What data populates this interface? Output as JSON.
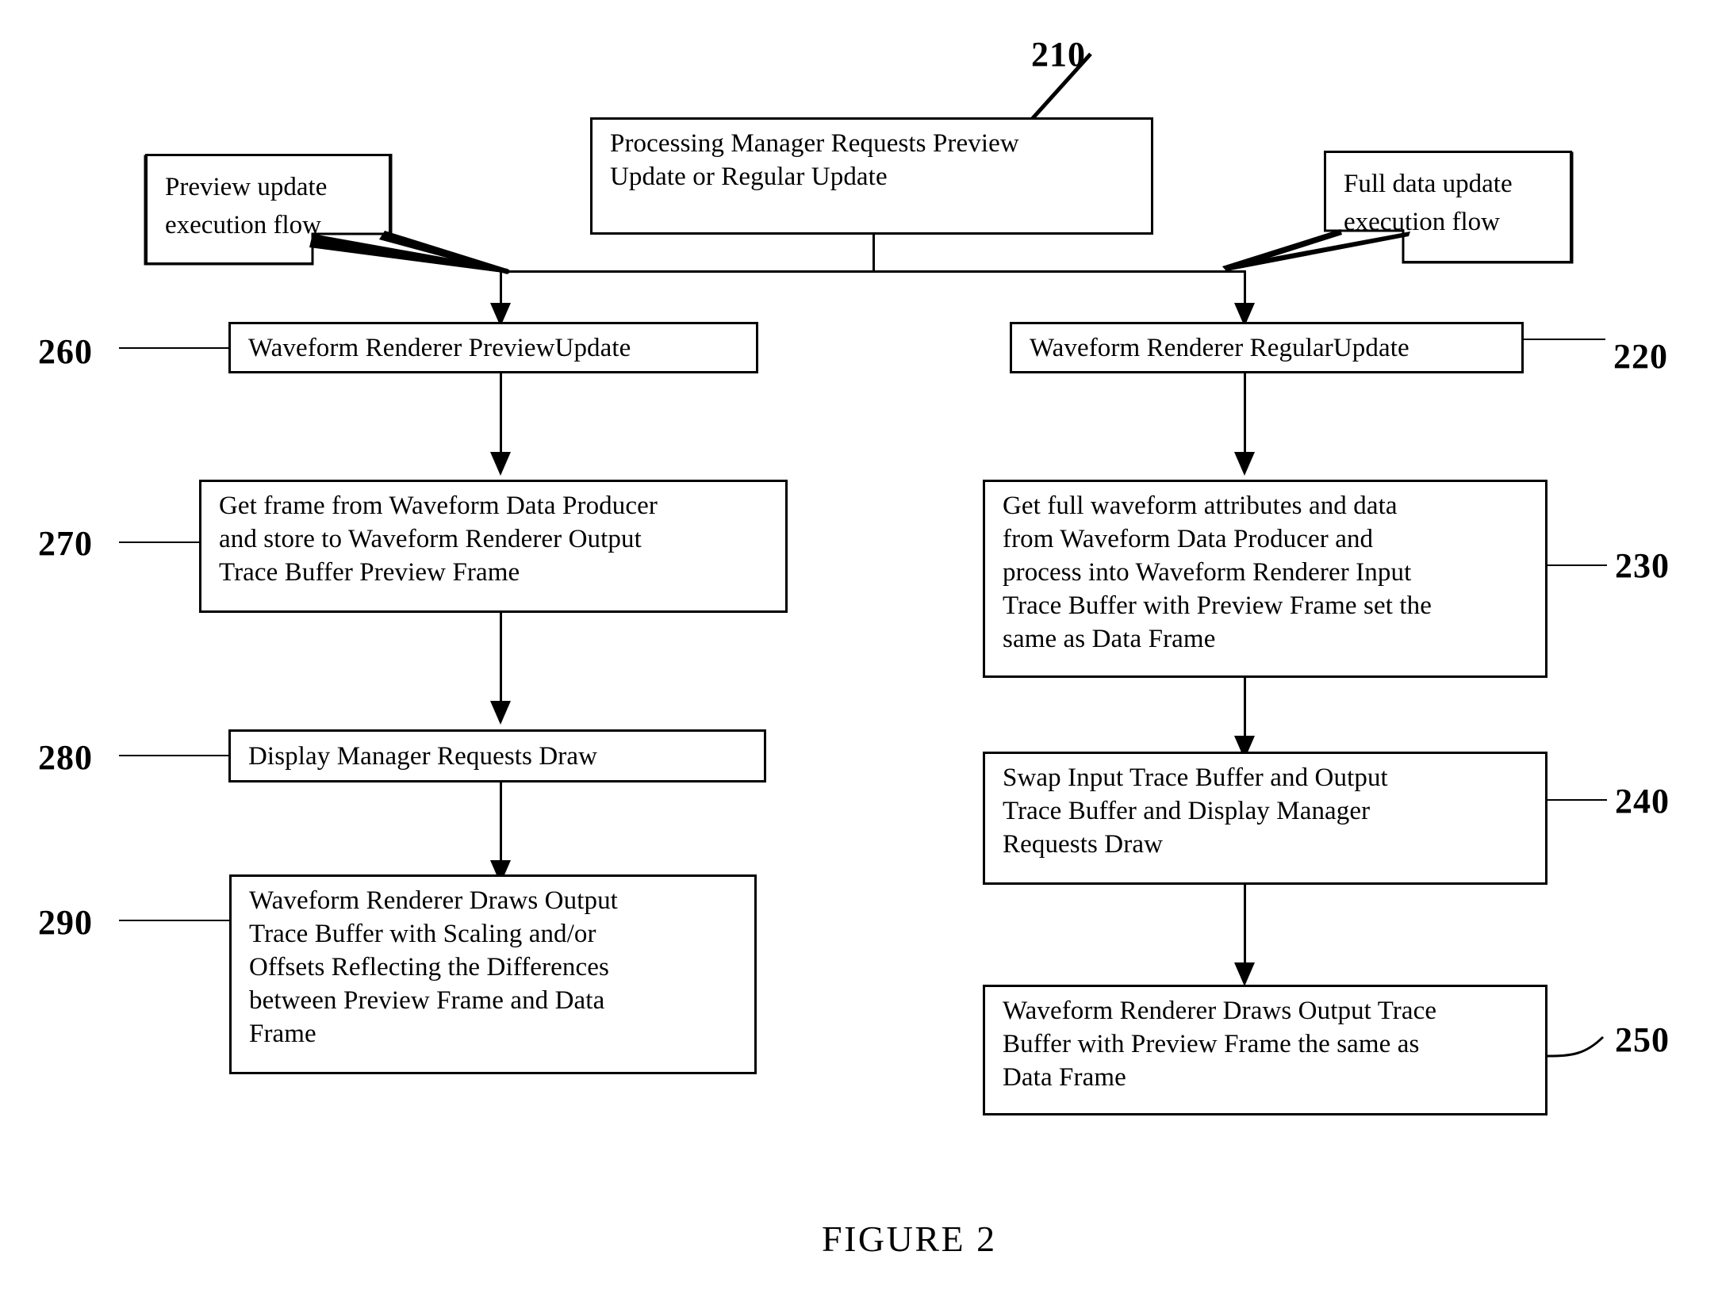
{
  "figure": {
    "caption": "FIGURE 2",
    "top_ref": "210"
  },
  "callouts": {
    "left": {
      "line1": "Preview update",
      "line2": "execution flow"
    },
    "right": {
      "line1": "Full data update",
      "line2": "execution flow"
    }
  },
  "nodes": {
    "start": {
      "ref": "210",
      "line1": "Processing Manager Requests Preview",
      "line2": "Update or Regular Update"
    },
    "preview_branch": [
      {
        "ref": "260",
        "ref_side": "left",
        "lines": [
          "Waveform Renderer PreviewUpdate"
        ]
      },
      {
        "ref": "270",
        "ref_side": "left",
        "lines": [
          "Get frame from Waveform Data Producer",
          "and store to Waveform Renderer Output",
          "Trace Buffer Preview Frame"
        ]
      },
      {
        "ref": "280",
        "ref_side": "left",
        "lines": [
          "Display Manager Requests Draw"
        ]
      },
      {
        "ref": "290",
        "ref_side": "left",
        "lines": [
          "Waveform Renderer Draws Output",
          "Trace Buffer with Scaling and/or",
          "Offsets Reflecting the Differences",
          "between Preview Frame and Data",
          "Frame"
        ]
      }
    ],
    "full_branch": [
      {
        "ref": "220",
        "ref_side": "right",
        "lines": [
          "Waveform Renderer RegularUpdate"
        ]
      },
      {
        "ref": "230",
        "ref_side": "right",
        "lines": [
          "Get full waveform attributes and data",
          "from Waveform Data Producer and",
          "process into Waveform Renderer Input",
          "Trace Buffer with Preview Frame set the",
          "same as Data Frame"
        ]
      },
      {
        "ref": "240",
        "ref_side": "right",
        "lines": [
          "Swap Input Trace Buffer and Output",
          "Trace Buffer and Display Manager",
          "Requests Draw"
        ]
      },
      {
        "ref": "250",
        "ref_side": "right",
        "lines": [
          "Waveform Renderer Draws Output Trace",
          "Buffer with Preview Frame the same as",
          "Data Frame"
        ]
      }
    ]
  },
  "colors": {
    "stroke": "#000000",
    "background": "#ffffff"
  }
}
